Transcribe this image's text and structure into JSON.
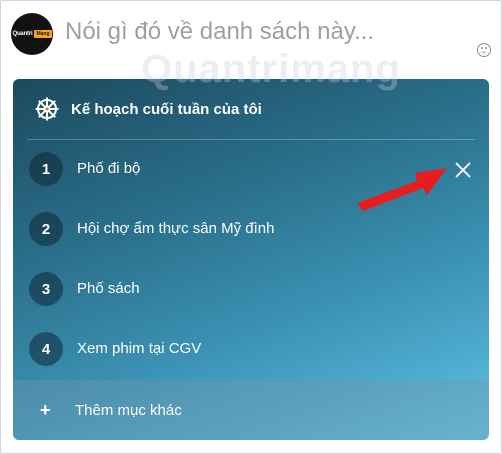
{
  "composer": {
    "avatar_text_1": "Quantri",
    "avatar_text_2": "Mang",
    "placeholder": "Nói gì đó về danh sách này..."
  },
  "watermark": "Quantrimang",
  "list": {
    "title": "Kế hoạch cuối tuần của tôi",
    "items": [
      {
        "number": "1",
        "label": "Phố đi bộ"
      },
      {
        "number": "2",
        "label": "Hội chợ ẩm thực sân Mỹ đình"
      },
      {
        "number": "3",
        "label": "Phố sách"
      },
      {
        "number": "4",
        "label": "Xem phim tại CGV"
      }
    ],
    "add_symbol": "+",
    "add_label": "Thêm mục khác"
  },
  "colors": {
    "card_gradient_start": "#1c4a5e",
    "card_gradient_end": "#5fc2e6",
    "arrow": "#e81c1c"
  },
  "icons": [
    "emoji-icon",
    "wheel-icon",
    "close-icon",
    "plus-icon",
    "arrow-annotation"
  ]
}
